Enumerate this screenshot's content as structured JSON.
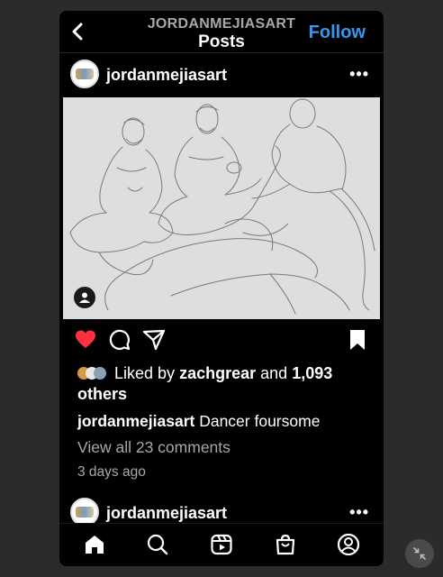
{
  "header": {
    "username": "JORDANMEJIASART",
    "title": "Posts",
    "follow_label": "Follow"
  },
  "post": {
    "username": "jordanmejiasart",
    "more": "•••",
    "liked_prefix": "Liked by",
    "liked_user": "zachgrear",
    "liked_and": "and",
    "liked_count": "1,093",
    "liked_suffix": "others",
    "caption_user": "jordanmejiasart",
    "caption_text": "Dancer foursome",
    "view_comments": "View all 23 comments",
    "time_ago": "3 days ago",
    "liked": true
  },
  "next_post": {
    "username": "jordanmejiasart",
    "more": "•••"
  },
  "icons": {
    "back": "chevron-left-icon",
    "like": "heart-icon",
    "comment": "comment-bubble-icon",
    "share": "send-icon",
    "save": "bookmark-icon",
    "home": "home-icon",
    "search": "search-icon",
    "reels": "reels-icon",
    "shop": "shopping-bag-icon",
    "profile": "profile-icon",
    "minimize": "minimize-arrows-icon"
  },
  "colors": {
    "accent": "#3797f0",
    "like": "#ff3040",
    "muted": "#a8a8a8"
  }
}
